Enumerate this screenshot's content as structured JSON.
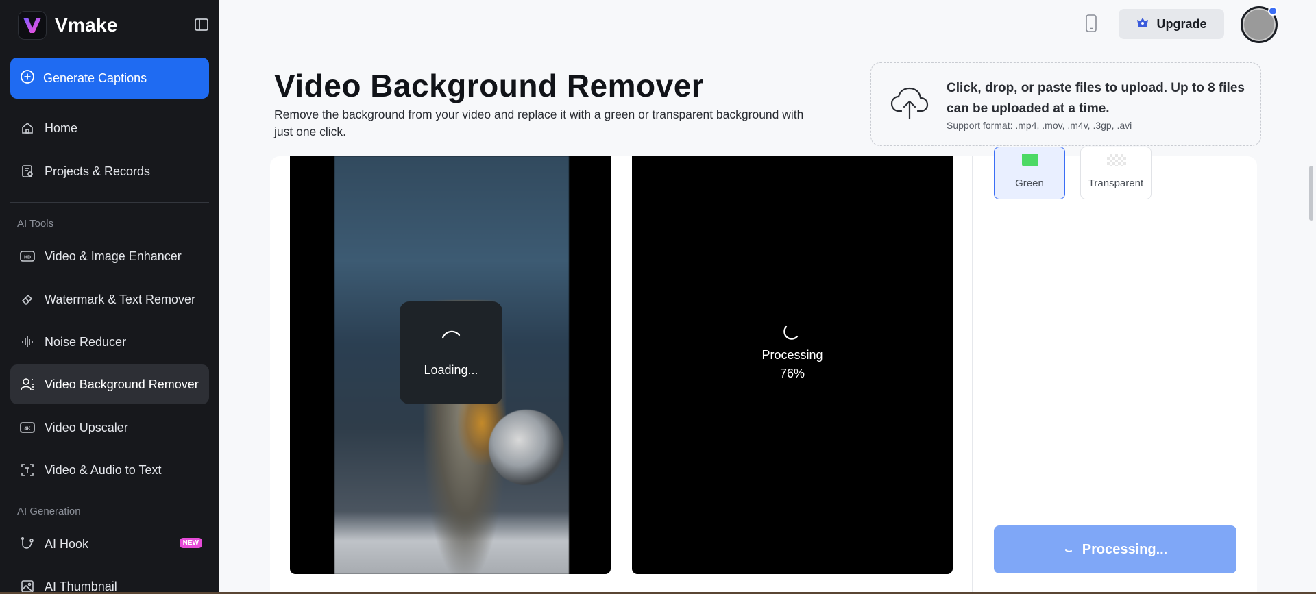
{
  "brand": {
    "name": "Vmake"
  },
  "sidebar": {
    "generate_label": "Generate Captions",
    "top_items": [
      {
        "label": "Home",
        "icon": "home-icon"
      },
      {
        "label": "Projects & Records",
        "icon": "records-icon"
      }
    ],
    "section_ai_tools": "AI Tools",
    "tools": [
      {
        "label": "Video & Image Enhancer",
        "icon": "hd-icon"
      },
      {
        "label": "Watermark & Text Remover",
        "icon": "eraser-icon"
      },
      {
        "label": "Noise Reducer",
        "icon": "waveform-icon"
      },
      {
        "label": "Video Background Remover",
        "icon": "person-cutout-icon",
        "active": true
      },
      {
        "label": "Video Upscaler",
        "icon": "4k-icon"
      },
      {
        "label": "Video & Audio to Text",
        "icon": "text-icon"
      }
    ],
    "section_ai_generation": "AI Generation",
    "generation": [
      {
        "label": "AI Hook",
        "icon": "hook-icon",
        "badge": "NEW"
      },
      {
        "label": "AI Thumbnail",
        "icon": "image-icon"
      }
    ]
  },
  "topbar": {
    "upgrade_label": "Upgrade"
  },
  "page": {
    "title": "Video Background Remover",
    "description": "Remove the background from your video and replace it with a green or transparent background with just one click."
  },
  "upload": {
    "main_text": "Click, drop, or paste files to upload. Up to 8 files can be uploaded at a time.",
    "formats": "Support format: .mp4, .mov, .m4v, .3gp, .avi"
  },
  "preview": {
    "loading_text": "Loading...",
    "processing_text": "Processing",
    "processing_percent": "76%"
  },
  "background_options": [
    {
      "label": "Green",
      "selected": true
    },
    {
      "label": "Transparent",
      "selected": false
    }
  ],
  "process_button": {
    "label": "Processing..."
  },
  "colors": {
    "accent": "#1f6bf2",
    "green": "#4cd964",
    "sidebar": "#17181c",
    "button_disabled": "#7fa7f7"
  }
}
